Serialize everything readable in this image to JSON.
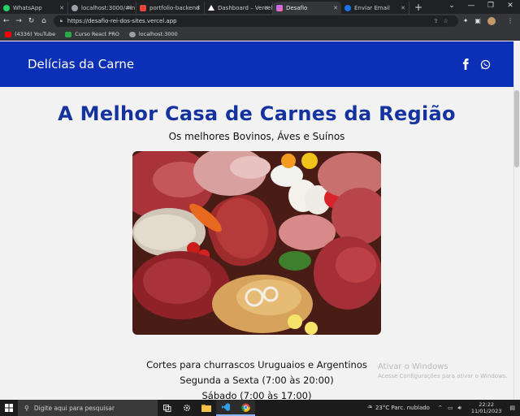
{
  "browser": {
    "tabs": [
      {
        "label": "WhatsApp",
        "color": "#25d366"
      },
      {
        "label": "localhost:3000/#in",
        "color": "#9aa0a6"
      },
      {
        "label": "portfolio-backend",
        "color": "#e0463a"
      },
      {
        "label": "Dashboard – Vercel",
        "color": "#ffffff"
      },
      {
        "label": "Desafio",
        "color": "#a66cff"
      },
      {
        "label": "Enviar Email",
        "color": "#1a73e8"
      }
    ],
    "active_tab": 4,
    "url": "https://desafio-rei-dos-sites.vercel.app",
    "bookmarks": [
      {
        "label": "(4336) YouTube",
        "color": "#ff0000"
      },
      {
        "label": "Curso React PRO",
        "color": "#2aa84a"
      },
      {
        "label": "localhost:3000",
        "color": "#9aa0a6"
      }
    ]
  },
  "site": {
    "brand": "Delícias da Carne",
    "header_color": "#0b2fb6",
    "social_icons": [
      "facebook-icon",
      "whatsapp-icon"
    ],
    "headline": "A Melhor Casa de Carnes da Região",
    "subheadline": "Os melhores Bovinos, Áves e Suínos",
    "info_lines": [
      "Cortes para churrascos Uruguaios e Argentinos",
      "Segunda a Sexta (7:00 às 20:00)",
      "Sábado (7:00 às 17:00)"
    ]
  },
  "windows": {
    "activation_title": "Ativar o Windows",
    "activation_text": "Acesse Configurações para ativar o Windows.",
    "search_placeholder": "Digite aqui para pesquisar",
    "weather": "23°C  Parc. nublado",
    "time": "22:22",
    "date": "11/01/2023"
  }
}
